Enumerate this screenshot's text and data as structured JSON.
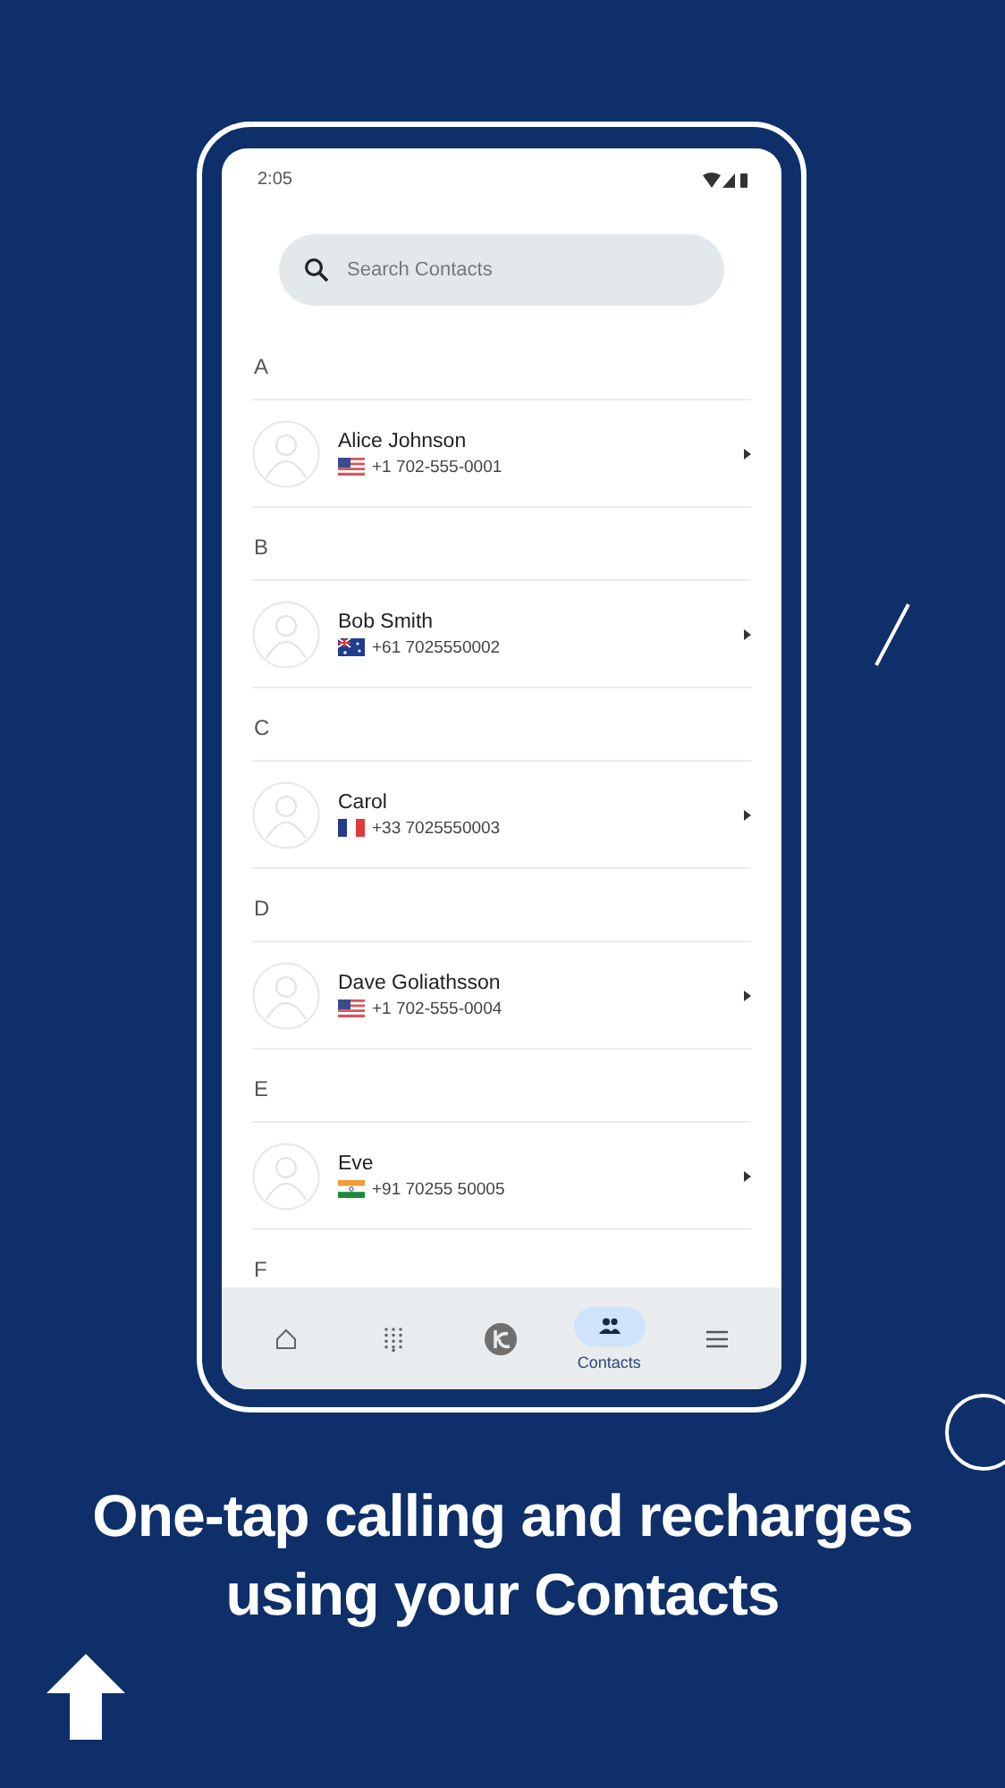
{
  "status_bar": {
    "time": "2:05"
  },
  "search": {
    "placeholder": "Search Contacts"
  },
  "sections": [
    {
      "letter": "A",
      "contacts": [
        {
          "name": "Alice Johnson",
          "kind": "us",
          "phone": "+1 702-555-0001"
        }
      ]
    },
    {
      "letter": "B",
      "contacts": [
        {
          "name": "Bob Smith",
          "kind": "au",
          "phone": "+61 7025550002"
        }
      ]
    },
    {
      "letter": "C",
      "contacts": [
        {
          "name": "Carol",
          "kind": "fr",
          "phone": "+33 7025550003"
        }
      ]
    },
    {
      "letter": "D",
      "contacts": [
        {
          "name": "Dave Goliathsson",
          "kind": "us",
          "phone": "+1 702-555-0004"
        }
      ]
    },
    {
      "letter": "E",
      "contacts": [
        {
          "name": "Eve",
          "kind": "in",
          "phone": "+91 70255 50005"
        }
      ]
    },
    {
      "letter": "F"
    }
  ],
  "bottom_nav": [
    {
      "kind": "home",
      "selected": false
    },
    {
      "kind": "dialpad",
      "selected": false
    },
    {
      "kind": "logo",
      "selected": false
    },
    {
      "kind": "contacts",
      "selected": true,
      "label": "Contacts"
    },
    {
      "kind": "menu",
      "selected": false
    }
  ],
  "headline": "One-tap calling and recharges using your Contacts"
}
